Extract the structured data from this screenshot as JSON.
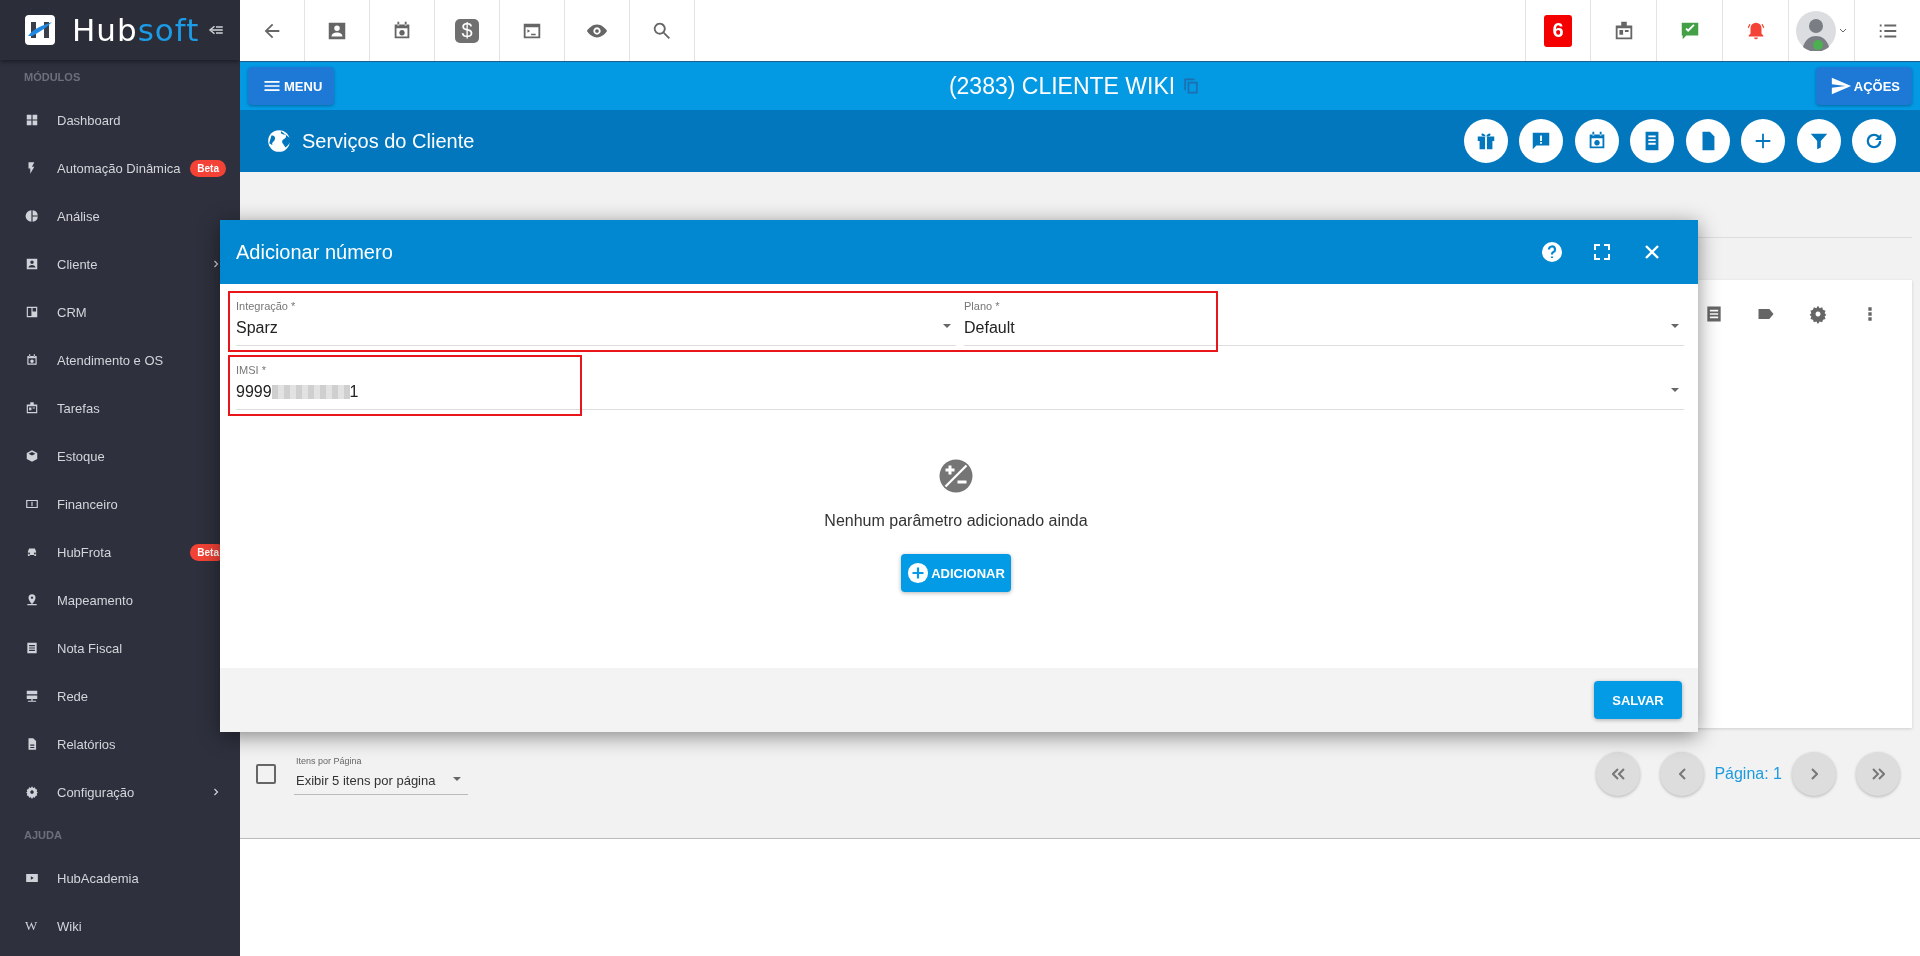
{
  "sidebar": {
    "brand": {
      "name_start": "Hub",
      "name_end": "soft"
    },
    "sections": [
      {
        "title": "MÓDULOS",
        "items": [
          {
            "label": "Dashboard",
            "has_submenu": false
          },
          {
            "label": "Automação Dinâmica",
            "badge": "Beta",
            "has_submenu": false
          },
          {
            "label": "Análise",
            "has_submenu": false
          },
          {
            "label": "Cliente",
            "has_submenu": true
          },
          {
            "label": "CRM",
            "has_submenu": false
          },
          {
            "label": "Atendimento e OS",
            "has_submenu": false
          },
          {
            "label": "Tarefas",
            "has_submenu": false
          },
          {
            "label": "Estoque",
            "has_submenu": false
          },
          {
            "label": "Financeiro",
            "has_submenu": false
          },
          {
            "label": "HubFrota",
            "badge": "Beta",
            "has_submenu": false
          },
          {
            "label": "Mapeamento",
            "has_submenu": false
          },
          {
            "label": "Nota Fiscal",
            "has_submenu": false
          },
          {
            "label": "Rede",
            "has_submenu": false
          },
          {
            "label": "Relatórios",
            "has_submenu": false
          },
          {
            "label": "Configuração",
            "has_submenu": true
          }
        ]
      },
      {
        "title": "AJUDA",
        "items": [
          {
            "label": "HubAcademia",
            "has_submenu": false
          },
          {
            "label": "Wiki",
            "glyph": "W",
            "has_submenu": false
          }
        ]
      }
    ]
  },
  "toolbar": {
    "quick_actions": [
      {
        "kind": "back"
      },
      {
        "kind": "contact"
      },
      {
        "kind": "calendar"
      },
      {
        "kind": "dollar",
        "glyph": "$"
      },
      {
        "kind": "terminal"
      },
      {
        "kind": "eye"
      },
      {
        "kind": "search"
      }
    ],
    "notifications": "6"
  },
  "client_bar": {
    "menu_button": "MENU",
    "title": "(2383) CLIENTE WIKI",
    "actions_button": "AÇÕES"
  },
  "section_bar": {
    "title": "Serviços do Cliente"
  },
  "modal": {
    "title": "Adicionar número",
    "rows": [
      {
        "highlighted": true,
        "fields": [
          {
            "label": "Integração *",
            "value": "Sparz"
          },
          {
            "label": "Plano *",
            "value": "Default"
          }
        ]
      },
      {
        "highlighted": true,
        "fields": [
          {
            "label": "IMSI *",
            "value_start": "9999",
            "redacted": true,
            "value_end": "1"
          }
        ]
      }
    ],
    "empty_text": "Nenhum parâmetro adicionado ainda",
    "add_button": "ADICIONAR",
    "save_button": "SALVAR"
  },
  "pagination": {
    "select_all": {
      "checked": false
    },
    "per_page_label": "Itens por Página",
    "per_page": "Exibir 5 itens por página",
    "page": "Página: 1"
  }
}
